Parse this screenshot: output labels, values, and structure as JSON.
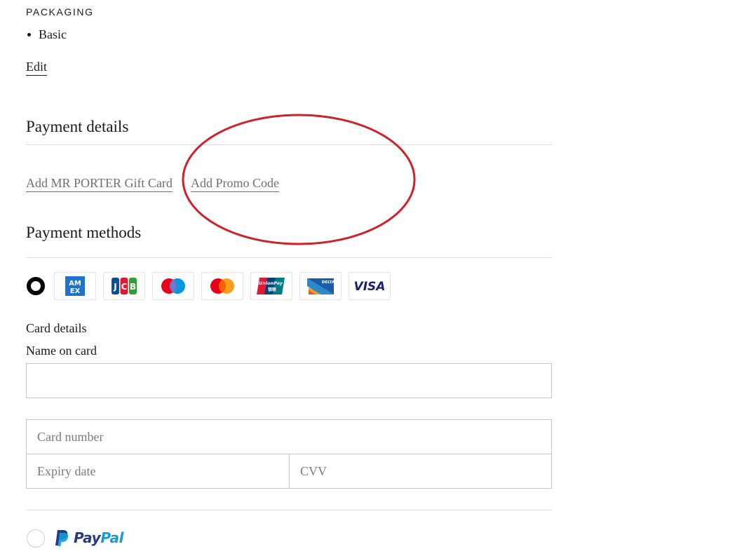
{
  "packaging": {
    "title": "PACKAGING",
    "item": "Basic",
    "edit_label": "Edit"
  },
  "payment_details": {
    "title": "Payment details",
    "gift_card_link": "Add MR PORTER Gift Card",
    "promo_code_link": "Add Promo Code"
  },
  "payment_methods": {
    "title": "Payment methods",
    "card_option_selected": true,
    "card_brands": [
      "AM EX",
      "JCB",
      "Maestro",
      "Mastercard",
      "UnionPay 银联",
      "DELTA",
      "VISA"
    ]
  },
  "card_details": {
    "title": "Card details",
    "name_label": "Name on card",
    "name_value": "",
    "card_number_placeholder": "Card number",
    "expiry_placeholder": "Expiry date",
    "cvv_placeholder": "CVV"
  },
  "paypal": {
    "label_pay": "Pay",
    "label_pal": "Pal",
    "selected": false
  },
  "colors": {
    "annotation_circle": "#d0202a",
    "amex_blue": "#1f72cd",
    "maestro_red": "#eb001b",
    "maestro_blue": "#0099df",
    "mastercard_orange": "#f79e1b",
    "unionpay_red": "#e21836",
    "unionpay_blue": "#00447c",
    "unionpay_teal": "#007b84",
    "visa_navy": "#1a1f71",
    "paypal_navy": "#253b80",
    "paypal_blue": "#179bd7"
  },
  "annotation": {
    "shape": "red-ellipse",
    "highlights": "Add Promo Code"
  }
}
